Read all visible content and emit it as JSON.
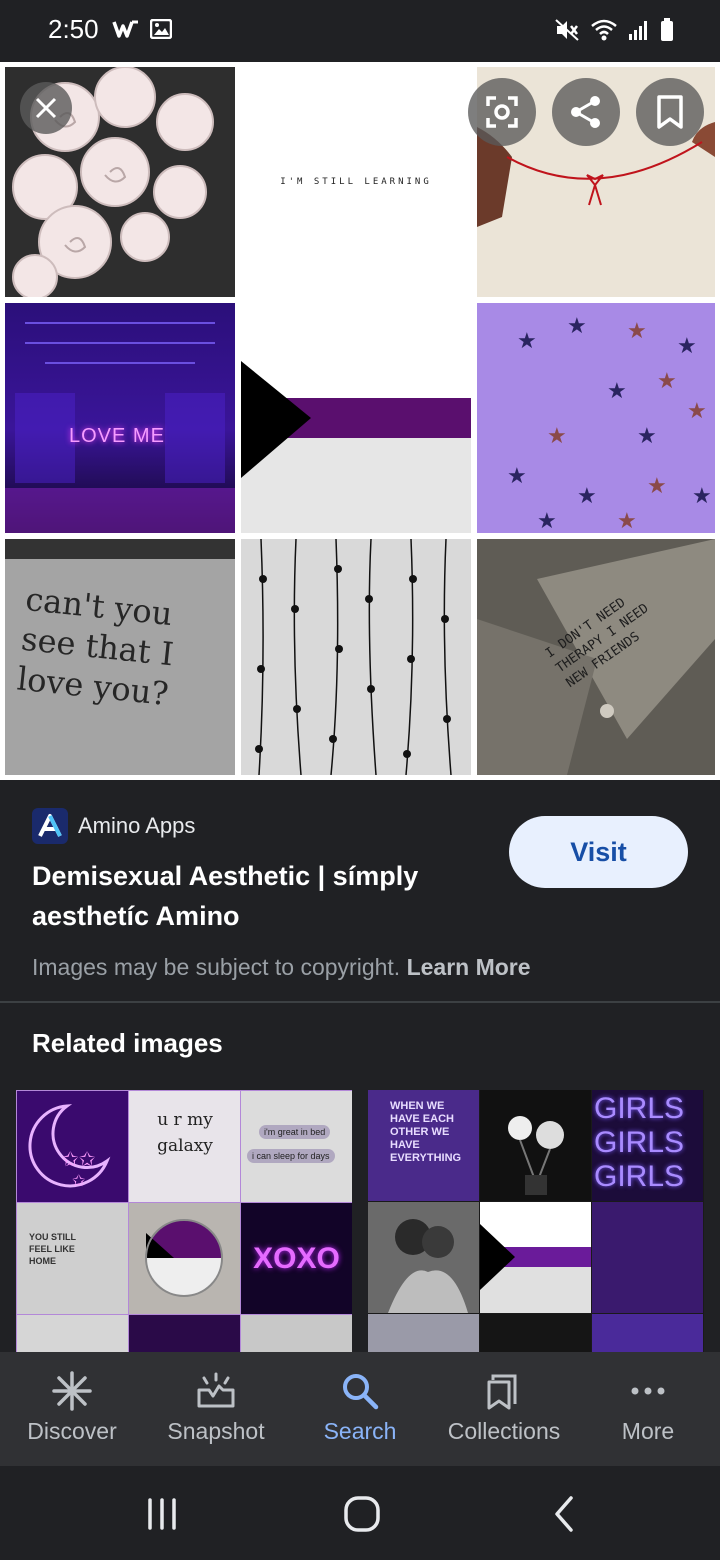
{
  "status_bar": {
    "time": "2:50"
  },
  "collage": {
    "text_tile": "I'M STILL LEARNING",
    "love_me_neon": "LOVE ME",
    "snow_text": "can't you see that I love you?",
    "collar_text": "I DON'T NEED THERAPY I NEED NEW FRIENDS",
    "overlay_icons": [
      "lens-icon",
      "share-icon",
      "bookmark-icon"
    ],
    "close_icon": "close-icon"
  },
  "info": {
    "source_name": "Amino Apps",
    "title": "Demisexual Aesthetic | símply aesthetíc Amino",
    "visit_label": "Visit",
    "copyright_text": "Images may be subject to copyright.",
    "learn_more_label": "Learn More"
  },
  "related": {
    "heading": "Related images",
    "left": {
      "galaxy_text": "u r my galaxy",
      "bed_text1": "i'm great in bed",
      "bed_text2": "i can sleep for days",
      "you_still_text": "YOU STILL FEEL LIKE HOME",
      "xoxo_text": "XOXO"
    },
    "right": {
      "when_text": "WHEN WE HAVE EACH OTHER WE HAVE EVERYTHING",
      "girls_text": "GIRLS"
    }
  },
  "bottom_nav": {
    "items": [
      {
        "label": "Discover",
        "icon": "asterisk-icon"
      },
      {
        "label": "Snapshot",
        "icon": "snapshot-icon"
      },
      {
        "label": "Search",
        "icon": "search-icon"
      },
      {
        "label": "Collections",
        "icon": "collections-icon"
      },
      {
        "label": "More",
        "icon": "more-icon"
      }
    ],
    "active": "Search"
  },
  "colors": {
    "background": "#202124",
    "accent": "#8ab4f8",
    "visit_bg": "#e8f0fe",
    "visit_text": "#174ea6",
    "purple": "#6a1b9a"
  }
}
